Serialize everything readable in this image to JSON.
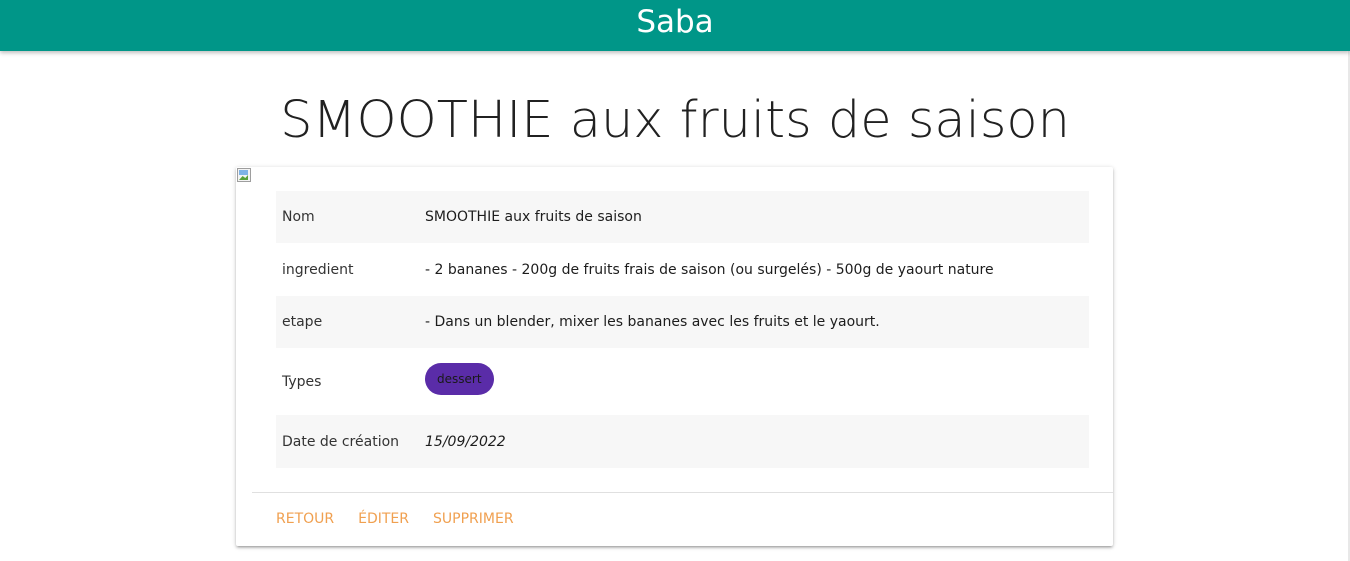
{
  "header": {
    "brand": "Saba",
    "color": "#009688"
  },
  "page": {
    "title": "SMOOTHIE aux fruits de saison"
  },
  "image": {
    "icon": "broken-image-icon"
  },
  "details": {
    "rows": [
      {
        "label": "Nom",
        "value": "SMOOTHIE aux fruits de saison"
      },
      {
        "label": "ingredient",
        "value": "- 2 bananes - 200g de fruits frais de saison (ou surgelés) - 500g de yaourt nature"
      },
      {
        "label": "etape",
        "value": "- Dans un blender, mixer les bananes avec les fruits et le yaourt."
      },
      {
        "label": "Types",
        "chip": "dessert",
        "chip_color": "#5a2ca8"
      },
      {
        "label": "Date de création",
        "value": "15/09/2022"
      }
    ]
  },
  "actions": {
    "back_label": "RETOUR",
    "edit_label": "ÉDITER",
    "delete_label": "SUPPRIMER",
    "color": "#f0a050"
  }
}
